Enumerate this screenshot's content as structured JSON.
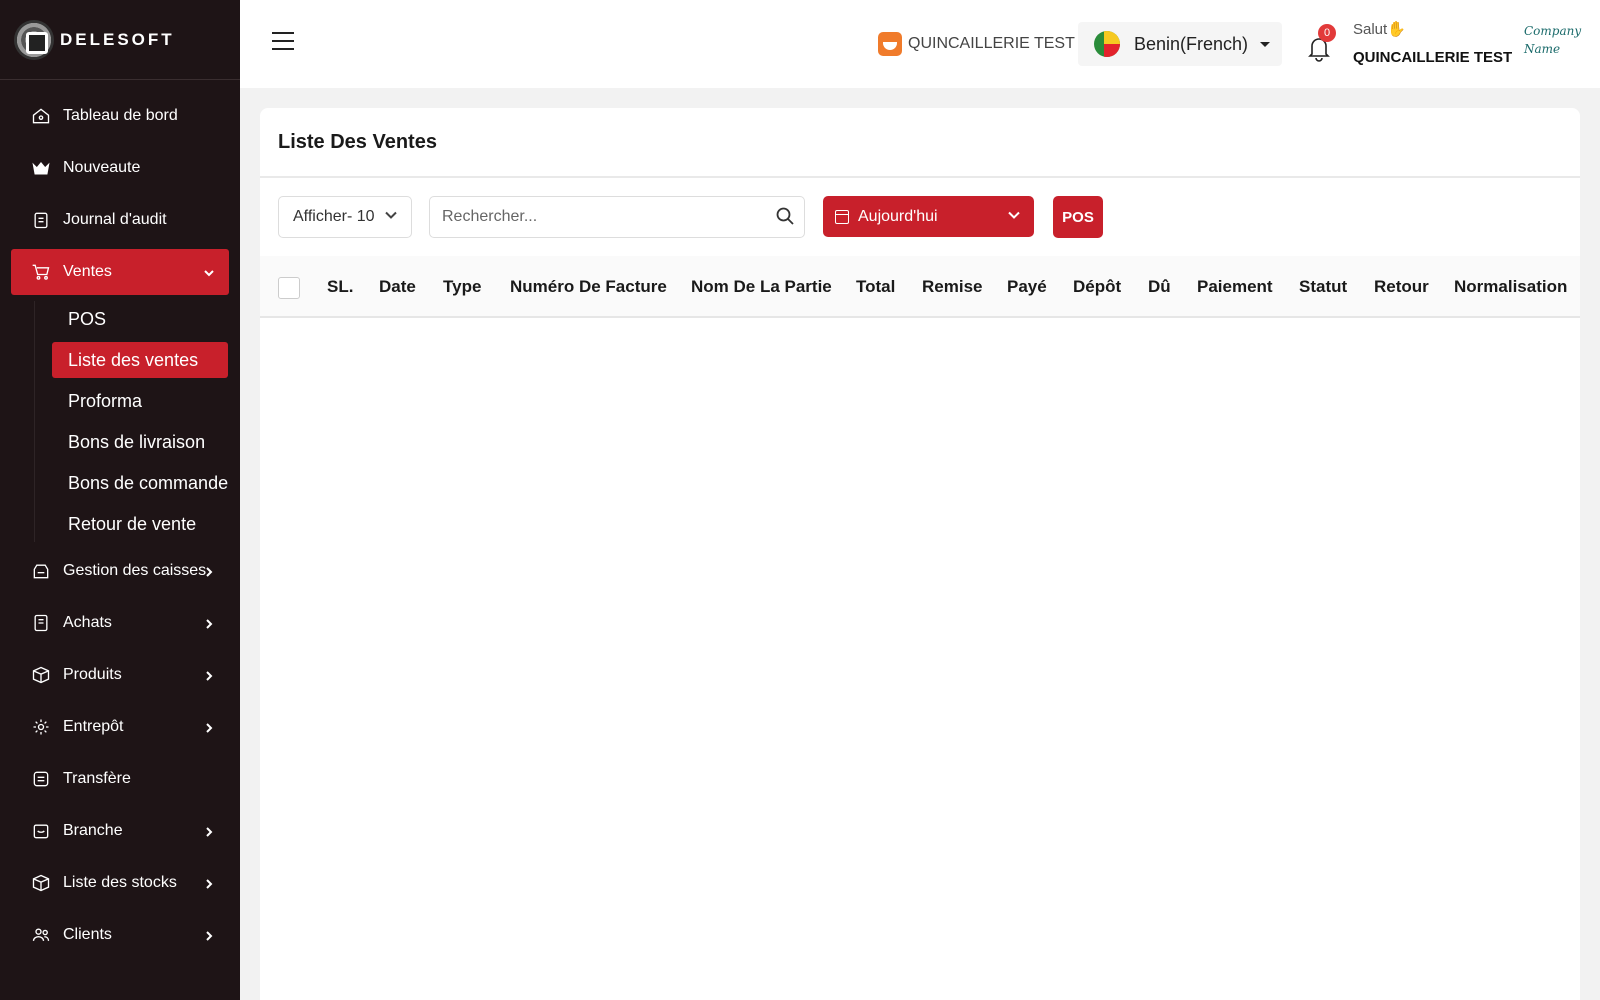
{
  "brand": {
    "name": "DELESOFT"
  },
  "sidebar": {
    "items": [
      {
        "label": "Tableau de bord",
        "icon": "home-icon"
      },
      {
        "label": "Nouveaute",
        "icon": "crown-icon"
      },
      {
        "label": "Journal d'audit",
        "icon": "clipboard-icon"
      },
      {
        "label": "Ventes",
        "icon": "cart-icon"
      },
      {
        "label": "Gestion des caisses",
        "icon": "cash-register-icon"
      },
      {
        "label": "Achats",
        "icon": "receipt-icon"
      },
      {
        "label": "Produits",
        "icon": "box-icon"
      },
      {
        "label": "Entrepôt",
        "icon": "gear-box-icon"
      },
      {
        "label": "Transfère",
        "icon": "transfer-icon"
      },
      {
        "label": "Branche",
        "icon": "branch-icon"
      },
      {
        "label": "Liste des stocks",
        "icon": "cube-icon"
      },
      {
        "label": "Clients",
        "icon": "users-icon"
      }
    ],
    "sales_submenu": [
      "POS",
      "Liste des ventes",
      "Proforma",
      "Bons de livraison",
      "Bons de commande",
      "Retour de vente"
    ]
  },
  "header": {
    "store_name": "QUINCAILLERIE TEST",
    "language": "Benin(French)",
    "notification_count": "0",
    "greeting": "Salut",
    "greeting_emoji": "✋",
    "user_name": "QUINCAILLERIE TEST",
    "company_logo_line1": "Company",
    "company_logo_line2": "Name"
  },
  "main": {
    "title": "Liste Des Ventes",
    "page_size_label": "Afficher- 10",
    "search_placeholder": "Rechercher...",
    "date_filter": "Aujourd'hui",
    "pos_button": "POS",
    "columns": [
      "SL.",
      "Date",
      "Type",
      "Numéro De Facture",
      "Nom De La Partie",
      "Total",
      "Remise",
      "Payé",
      "Dépôt",
      "Dû",
      "Paiement",
      "Statut",
      "Retour",
      "Normalisation"
    ]
  },
  "colors": {
    "accent": "#c8202b",
    "sidebar_bg": "#1e1416",
    "store_icon": "#f07b2b"
  }
}
